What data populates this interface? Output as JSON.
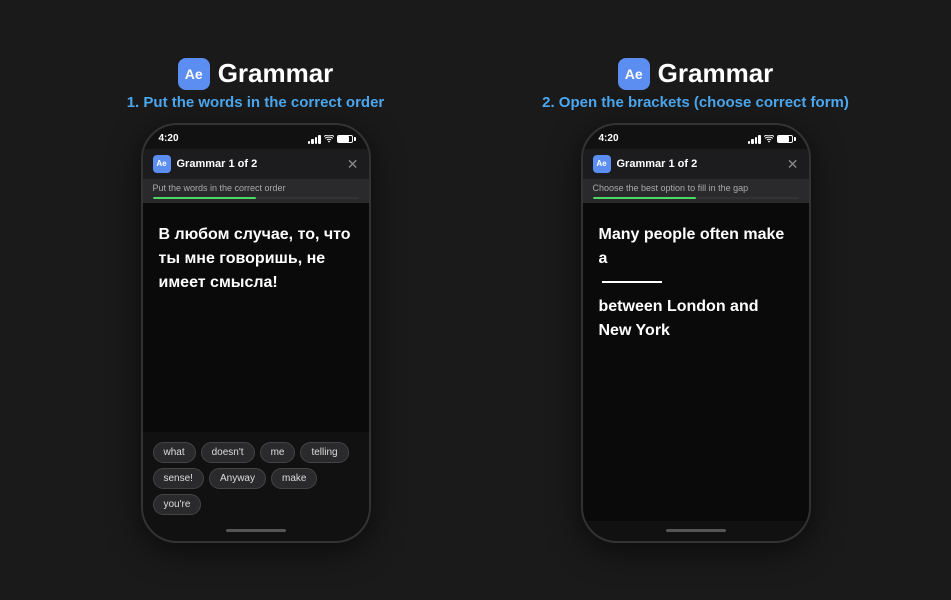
{
  "panel1": {
    "app_name": "Grammar",
    "subtitle": "1. Put the words in the correct order",
    "phone": {
      "status_time": "4:20",
      "header_title": "Grammar 1 of 2",
      "instruction": "Put the words in the correct order",
      "progress_pct": 50,
      "main_text": "В любом случае, то, что ты мне говоришь, не имеет смысла!",
      "chips": [
        "what",
        "doesn't",
        "me",
        "telling",
        "sense!",
        "Anyway",
        "make",
        "you're"
      ]
    }
  },
  "panel2": {
    "app_name": "Grammar",
    "subtitle": "2. Open the brackets (choose correct form)",
    "phone": {
      "status_time": "4:20",
      "header_title": "Grammar 1 of 2",
      "instruction": "Choose the best option to fill in the gap",
      "progress_pct": 50,
      "main_text_before": "Many people often make a",
      "main_text_after": "between London and New York",
      "blank_label": "___"
    }
  },
  "icons": {
    "app_icon_label": "Ae",
    "close_symbol": "✕",
    "signal_symbol": "▐",
    "wifi_symbol": "wifi",
    "battery_symbol": "battery"
  }
}
